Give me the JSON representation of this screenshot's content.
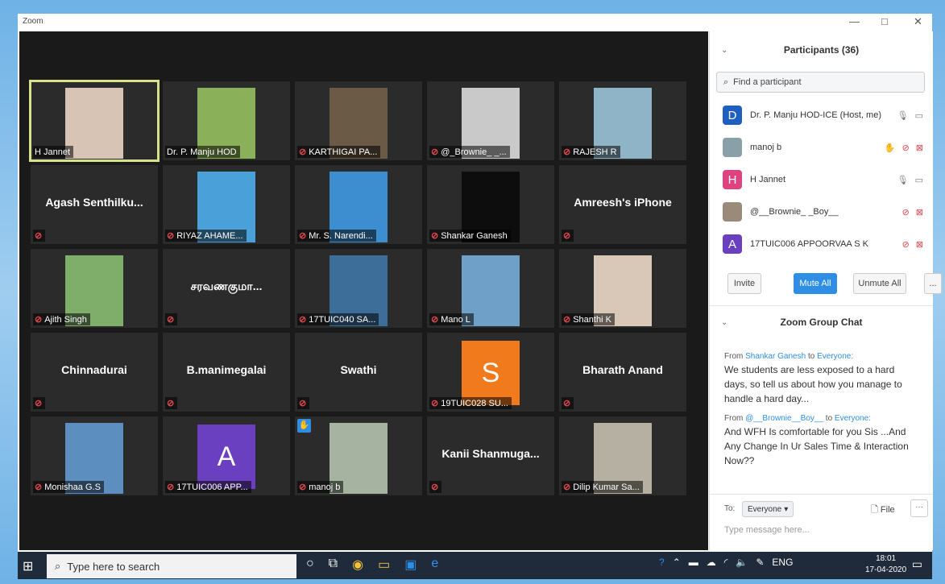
{
  "window": {
    "title": "Zoom",
    "minimize": "—",
    "maximize": "□",
    "close": "✕"
  },
  "tiles": [
    {
      "name": "H Jannet",
      "type": "video",
      "bg": "#d8c4b5",
      "active": true,
      "muted": false
    },
    {
      "name": "Dr. P. Manju HOD",
      "type": "video",
      "bg": "#8ab05a",
      "muted": false
    },
    {
      "name": "KARTHIGAI PA...",
      "type": "video",
      "bg": "#6b5a45",
      "muted": true
    },
    {
      "name": "@_Brownie_ _...",
      "type": "video",
      "bg": "#c9c9c9",
      "muted": true
    },
    {
      "name": "RAJESH R",
      "type": "video",
      "bg": "#8fb3c7",
      "muted": true
    },
    {
      "display": "Agash  Senthilku...",
      "type": "text",
      "muted": true
    },
    {
      "name": "RIYAZ AHAME...",
      "type": "video",
      "bg": "#4aa0d8",
      "muted": true
    },
    {
      "name": "Mr. S. Narendi...",
      "type": "video",
      "bg": "#3d8ed0",
      "muted": true
    },
    {
      "name": "Shankar Ganesh",
      "type": "video",
      "bg": "#0d0d0d",
      "muted": true
    },
    {
      "display": "Amreesh's iPhone",
      "type": "text",
      "muted": true
    },
    {
      "name": "Ajith Singh",
      "type": "video",
      "bg": "#7fae6a",
      "muted": true
    },
    {
      "display": "சரவணகுமா...",
      "type": "text",
      "muted": true
    },
    {
      "name": "17TUIC040 SA...",
      "type": "video",
      "bg": "#3c6e99",
      "muted": true
    },
    {
      "name": "Mano L",
      "type": "video",
      "bg": "#6fa1c8",
      "muted": true
    },
    {
      "name": "Shanthi K",
      "type": "video",
      "bg": "#d9c8b8",
      "muted": true
    },
    {
      "display": "Chinnadurai",
      "type": "text",
      "muted": true
    },
    {
      "display": "B.manimegalai",
      "type": "text",
      "muted": true
    },
    {
      "display": "Swathi",
      "type": "text",
      "muted": true
    },
    {
      "name": "19TUIC028 SU...",
      "type": "avatar",
      "letter": "S",
      "bg": "#f07a1c",
      "muted": true
    },
    {
      "display": "Bharath Anand",
      "type": "text",
      "muted": true
    },
    {
      "name": "Monishaa G.S",
      "type": "video",
      "bg": "#5c8fbf",
      "muted": true
    },
    {
      "name": "17TUIC006 APP...",
      "type": "avatar",
      "letter": "A",
      "bg": "#6a3fc0",
      "muted": true
    },
    {
      "name": "manoj b",
      "type": "video",
      "bg": "#a5b3a0",
      "muted": true,
      "hand": true
    },
    {
      "display": "Kanii  Shanmuga...",
      "type": "text",
      "muted": true
    },
    {
      "name": "Dilip Kumar Sa...",
      "type": "video",
      "bg": "#b6b0a2",
      "muted": true
    }
  ],
  "panel": {
    "participants_title": "Participants (36)",
    "search_placeholder": "Find a participant",
    "participants": [
      {
        "letter": "D",
        "color": "#1f5fbf",
        "name": "Dr. P. Manju HOD-ICE (Host, me)",
        "mic": "on",
        "cam": "on"
      },
      {
        "letter": "",
        "color": "#8aa0a8",
        "name": "manoj b",
        "mic": "off",
        "cam": "off",
        "hand": true
      },
      {
        "letter": "H",
        "color": "#e0427f",
        "name": "H Jannet",
        "mic": "on",
        "cam": "on"
      },
      {
        "letter": "",
        "color": "#9a8a7a",
        "name": "@__Brownie_ _Boy__",
        "mic": "off",
        "cam": "off"
      },
      {
        "letter": "A",
        "color": "#6a3fc0",
        "name": "17TUIC006 APPOORVAA S K",
        "mic": "off",
        "cam": "off"
      }
    ],
    "invite": "Invite",
    "mute_all": "Mute All",
    "unmute_all": "Unmute All",
    "more": "...",
    "chat_title": "Zoom Group Chat",
    "messages": [
      {
        "from_prefix": "From",
        "from": "Shankar Ganesh",
        "to_word": "to",
        "to": "Everyone:",
        "text": "We students are less exposed to a hard days, so tell us about how you manage to handle a hard day..."
      },
      {
        "from_prefix": "From",
        "from": "@__Brownie__Boy__",
        "to_word": "to",
        "to": "Everyone:",
        "text": "And WFH Is comfortable for you Sis ...And Any Change In Ur Sales Time & Interaction Now??"
      }
    ],
    "to_label": "To:",
    "to_value": "Everyone",
    "file_label": "File",
    "type_placeholder": "Type message here..."
  },
  "taskbar": {
    "search_placeholder": "Type here to search",
    "lang": "ENG",
    "time": "18:01",
    "date": "17-04-2020"
  }
}
